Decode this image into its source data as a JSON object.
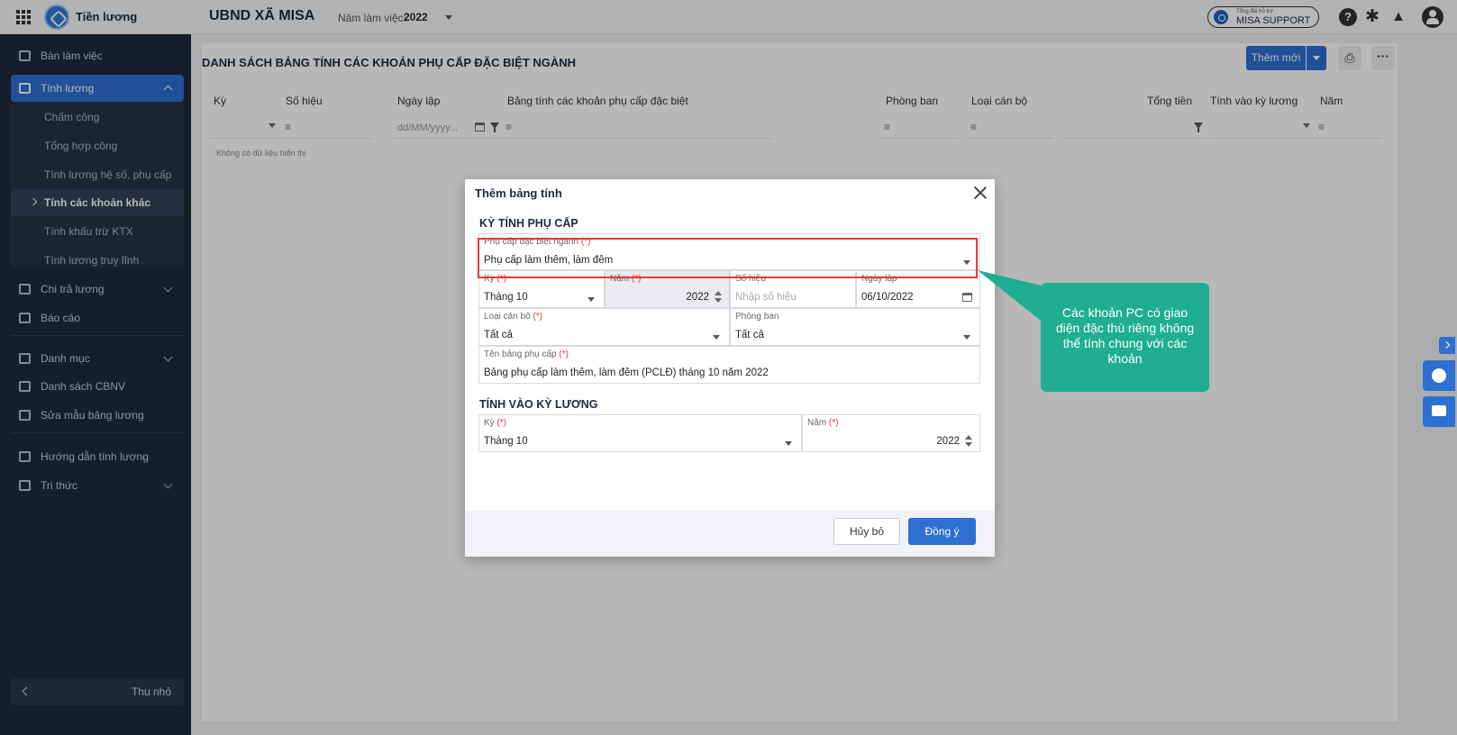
{
  "topbar": {
    "app_name": "Tiền lương",
    "org_name": "UBND XÃ MISA",
    "year_label": "Năm làm việc:",
    "year_value": "2022",
    "support_small": "Tổng đài hỗ trợ",
    "support_label": "MISA SUPPORT"
  },
  "sidebar": {
    "items": [
      {
        "label": "Bàn làm việc"
      },
      {
        "label": "Tính lương"
      },
      {
        "label": "Chi trả lương"
      },
      {
        "label": "Báo cáo"
      },
      {
        "label": "Danh mục"
      },
      {
        "label": "Danh sách CBNV"
      },
      {
        "label": "Sửa mẫu bảng lương"
      },
      {
        "label": "Hướng dẫn tính lương"
      },
      {
        "label": "Tri thức"
      }
    ],
    "sub_items": [
      {
        "label": "Chấm công"
      },
      {
        "label": "Tổng hợp công"
      },
      {
        "label": "Tính lương hệ số, phụ cấp"
      },
      {
        "label": "Tính các khoản khác"
      },
      {
        "label": "Tính khấu trừ KTX"
      },
      {
        "label": "Tính lương truy lĩnh"
      }
    ],
    "collapse_label": "Thu nhỏ"
  },
  "page": {
    "title": "DANH SÁCH BẢNG TÍNH CÁC KHOẢN PHỤ CẤP ĐẶC BIỆT NGÀNH",
    "add_button": "Thêm mới",
    "columns": [
      "Kỳ",
      "Số hiệu",
      "Ngày lập",
      "Bảng tính các khoản phụ cấp đặc biệt",
      "Phòng ban",
      "Loại cán bộ",
      "Tổng tiền",
      "Tính vào kỳ lương",
      "Năm"
    ],
    "date_placeholder": "dd/MM/yyyy...",
    "empty_message": "Không có dữ liệu hiển thị"
  },
  "dialog": {
    "title": "Thêm bảng tính",
    "section1": "KỲ TÍNH PHỤ CẤP",
    "section2": "TÍNH VÀO KỲ LƯƠNG",
    "required_mark": "(*)",
    "fields": {
      "allowance_type": {
        "label": "Phụ cấp đặc biệt ngành",
        "value": "Phụ cấp làm thêm, làm đêm"
      },
      "period": {
        "label": "Kỳ",
        "value": "Tháng 10"
      },
      "year": {
        "label": "Năm",
        "value": "2022"
      },
      "doc_no": {
        "label": "Số hiệu",
        "placeholder": "Nhập số hiệu"
      },
      "date": {
        "label": "Ngày lập",
        "value": "06/10/2022"
      },
      "staff_type": {
        "label": "Loại cán bộ",
        "value": "Tất cả"
      },
      "department": {
        "label": "Phòng ban",
        "value": "Tất cả"
      },
      "table_name": {
        "label": "Tên bảng phụ cấp",
        "value": "Bảng phụ cấp làm thêm, làm đêm (PCLĐ) tháng 10 năm 2022"
      },
      "salary_period": {
        "label": "Kỳ",
        "value": "Tháng 10"
      },
      "salary_year": {
        "label": "Năm",
        "value": "2022"
      }
    },
    "cancel_label": "Hủy bỏ",
    "ok_label": "Đồng ý"
  },
  "callout": {
    "text": "Các khoản PC có giao diện đặc thù riêng không thể tính chung với các khoản"
  },
  "colors": {
    "primary": "#2d6fd2",
    "sidebar": "#1f2a3d",
    "callout": "#1fae92",
    "highlight": "#e53935"
  }
}
